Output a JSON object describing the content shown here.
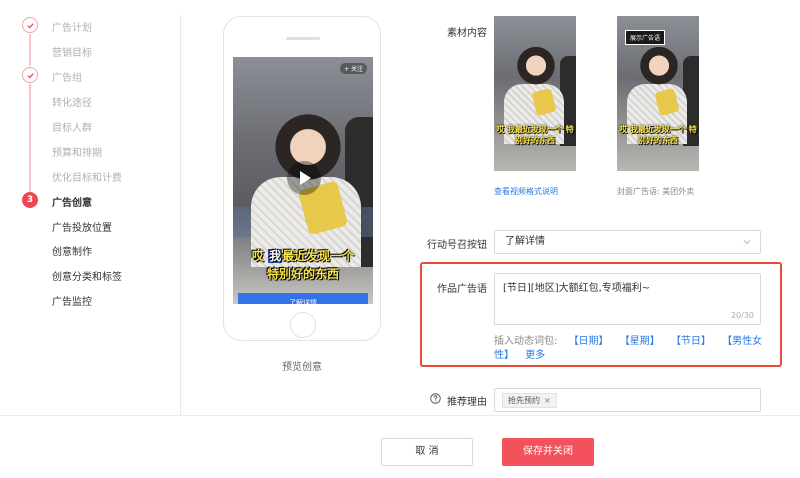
{
  "steps": [
    {
      "label": "广告计划",
      "state": "done"
    },
    {
      "label": "营销目标",
      "state": "sub"
    },
    {
      "label": "广告组",
      "state": "done"
    },
    {
      "label": "转化途径",
      "state": "sub"
    },
    {
      "label": "目标人群",
      "state": "sub"
    },
    {
      "label": "预算和排期",
      "state": "sub"
    },
    {
      "label": "优化目标和计费",
      "state": "sub"
    },
    {
      "label": "广告创意",
      "state": "current",
      "number": "3"
    },
    {
      "label": "广告投放位置",
      "state": "sub-active"
    },
    {
      "label": "创意制作",
      "state": "sub-active"
    },
    {
      "label": "创意分类和标签",
      "state": "sub-active"
    },
    {
      "label": "广告监控",
      "state": "sub-active"
    }
  ],
  "preview": {
    "tag": "+ 关注",
    "caption_line1_hl": "我",
    "caption_line1_pre": "哎 ",
    "caption_line1_rest": "最近发现一个",
    "caption_line2": "特别好的东西",
    "cta": "了解详情",
    "label": "预览创意"
  },
  "material": {
    "label": "素材内容",
    "thumb1_caption": "哎 我最近发现一个 特别好的东西",
    "thumb2_badge": "展示广告语",
    "thumb2_caption": "哎 我最近发现一个 特别好的东西",
    "link": "查看视频格式说明",
    "cover_caption": "封面广告语: 美团外卖"
  },
  "cta_field": {
    "label": "行动号召按钮",
    "value": "了解详情"
  },
  "ad_copy": {
    "label": "作品广告语",
    "value": "[节日][地区]大额红包,专项福利~",
    "count": "20/30",
    "tokens_label": "插入动态词包:",
    "tokens": [
      "【日期】",
      "【星期】",
      "【节日】",
      "【男性女性】"
    ],
    "more": "更多"
  },
  "reason": {
    "label": "推荐理由",
    "chip": "抢先预约"
  },
  "footer": {
    "cancel": "取 消",
    "save": "保存并关闭"
  },
  "colors": {
    "accent": "#f04654",
    "link": "#2a7ae2",
    "highlight": "#ea4b36"
  }
}
